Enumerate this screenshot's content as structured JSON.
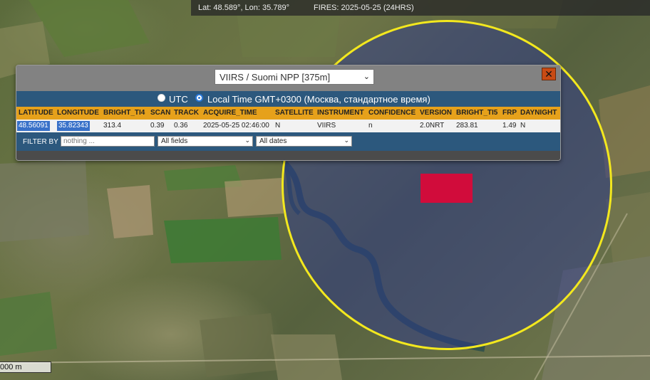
{
  "status_bar": {
    "coords": "Lat: 48.589°, Lon: 35.789°",
    "fires": "FIRES: 2025-05-25 (24HRS)"
  },
  "popup": {
    "satellite_selected": "VIIRS / Suomi NPP [375m]",
    "close_label": "✕",
    "time_options": [
      "UTC",
      "Local Time GMT+0300 (Москва, стандартное время)"
    ],
    "time_selected": "Local Time GMT+0300 (Москва, стандартное время)",
    "columns": [
      "LATITUDE",
      "LONGITUDE",
      "BRIGHT_TI4",
      "SCAN",
      "TRACK",
      "ACQUIRE_TIME",
      "SATELLITE",
      "INSTRUMENT",
      "CONFIDENCE",
      "VERSION",
      "BRIGHT_TI5",
      "FRP",
      "DAYNIGHT"
    ],
    "rows": [
      [
        "48.56091",
        "35.82343",
        "313.4",
        "0.39",
        "0.36",
        "2025-05-25 02:46:00",
        "N",
        "VIIRS",
        "n",
        "2.0NRT",
        "283.81",
        "1.49",
        "N"
      ]
    ],
    "filter": {
      "label": "FILTER BY",
      "placeholder": "nothing ...",
      "field_selected": "All fields",
      "date_selected": "All dates"
    }
  },
  "scale_bar": {
    "label": "000 m"
  },
  "colors": {
    "highlight_circle": "#f3e81e",
    "fire_marker": "#d10c3b",
    "table_header": "#e6a11b",
    "panel_band": "#2c587d"
  }
}
